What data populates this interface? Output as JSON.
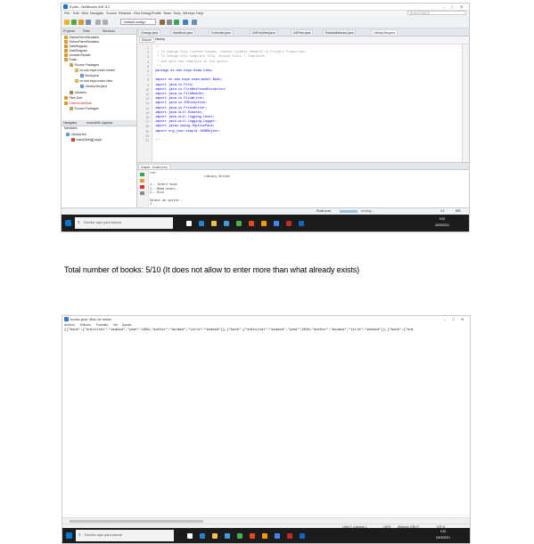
{
  "shot1": {
    "window_title": "Evals - NetBeans IDE 8.2",
    "menu": [
      "File",
      "Edit",
      "View",
      "Navigate",
      "Source",
      "Refactor",
      "Run",
      "Debug",
      "Profile",
      "Team",
      "Tools",
      "Window",
      "Help"
    ],
    "search_placeholder": "Search (Ctrl+I)",
    "config": "<default config>",
    "left_tabs": [
      "Projects",
      "Files",
      "Services"
    ],
    "tree": [
      "DivisorParmSimulator",
      "DivisorParmSimulator",
      "DateDiagram",
      "DateDiagram",
      "Uniceta Reader",
      "Evals",
      "Source Packages",
      "ec.edu.espe.exam.model",
      "Book.java",
      "ec.edu.espe.exam.view",
      "LibraryUtm.java",
      "Libraries",
      "Files Sort",
      "EsteveNoteRadi",
      "Source Packages"
    ],
    "navigator_tabs": [
      "Navigator",
      "examUML.bgdraw"
    ],
    "members_label": "Members",
    "navigator_items": [
      "LibraryUtm",
      "main(String[] args)"
    ],
    "editor_tabs": [
      "Change.java",
      "NoteBook.java",
      "Controller.java",
      "UdProdView.java",
      "UdPrice.java",
      "EstadoMatacion.java",
      "LibraryUtm.java"
    ],
    "editor_mode_tabs": [
      "Source",
      "History"
    ],
    "line_numbers": [
      "1",
      "2",
      "3",
      "4",
      "5",
      "6",
      "7",
      "8",
      "9",
      "10",
      "11",
      "12",
      "13",
      "14",
      "15",
      "16",
      "17",
      "18",
      "19",
      "20",
      "21",
      "22",
      "23",
      "24",
      "25"
    ],
    "code": [
      "/*",
      " * To change this license header, choose License Headers in Project Properties.",
      " * To change this template file, choose Tools | Templates",
      " * and open the template in the editor.",
      " */",
      "package ec.edu.espe.exam.view;",
      "",
      "import ec.edu.espe.exam.model.Book;",
      "import java.io.File;",
      "import java.io.FileNotFoundException;",
      "import java.io.FileReader;",
      "import java.io.FileWriter;",
      "import java.io.IOException;",
      "import java.io.PrintWriter;",
      "import java.util.Scanner;",
      "import java.util.logging.Level;",
      "import java.util.logging.Logger;",
      "import javax.swing.JOptionPane;",
      "import org.json.simple.JSONObject;",
      "",
      "/** ..."
    ],
    "output_tab": "Output - Evals (run)",
    "output_lines": [
      "run:",
      "                              Library Online",
      "",
      "1.- Insert book",
      "2.- Read books",
      "3.- Exit",
      "",
      "Select an option :",
      "1"
    ],
    "status_run": "Evals (run)",
    "status_running": "running...",
    "status_pos": "1:1",
    "status_ins": "INS",
    "taskbar_search": "Escribe aquí para buscar",
    "clock_time": "9:25",
    "clock_date": "20/05/2021"
  },
  "caption": "Total number of books: 5/10  (It does not allow to enter more than what already exists)",
  "shot2": {
    "window_title": "books.json: Bloc de notas",
    "menu": [
      "Archivo",
      "Edición",
      "Formato",
      "Ver",
      "Ayuda"
    ],
    "content": "[{\"book\":{\"editorial\":\"asdasd\",\"year\":1999,\"author\":\"asdasd\",\"title\":\"asdasd\"}},{\"book\":{\"editorial\":\"asdasd\",\"year\":2010,\"author\":\"asdasd\",\"title\":\"asdasd\"}},{\"book\":{\"edi",
    "status_position": "Línea 1, columna 1",
    "status_zoom": "100%",
    "status_eol": "Windows (CRLF)",
    "status_encoding": "UTF-8",
    "taskbar_search": "Escribe aquí para buscar",
    "clock_time": "9:25",
    "clock_date": "20/05/2021"
  },
  "colors": {
    "keyword": "#0000e6",
    "comment": "#969696",
    "taskbar": "#1c1c1c"
  }
}
